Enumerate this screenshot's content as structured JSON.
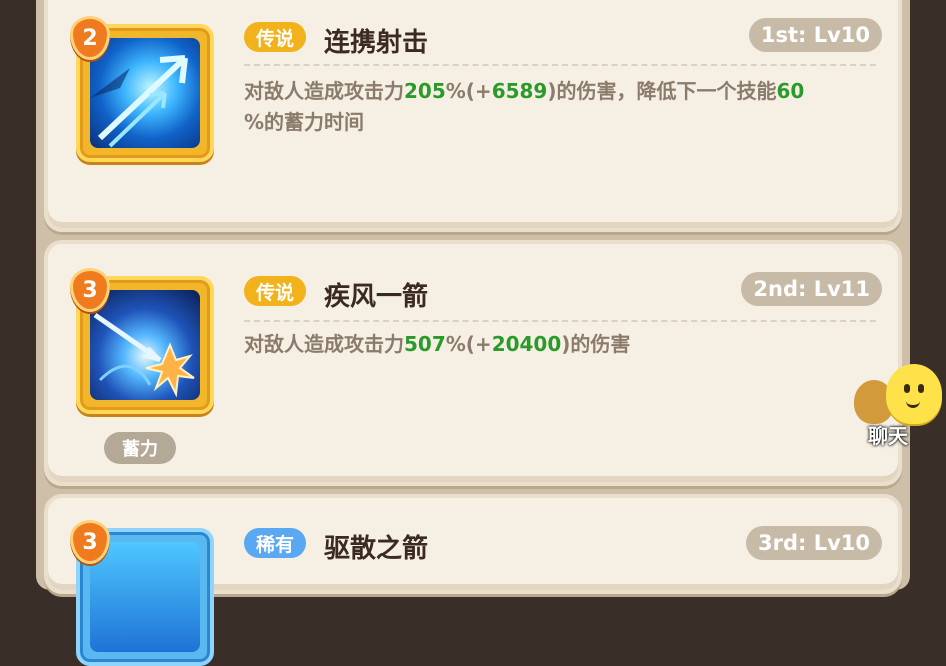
{
  "skills": [
    {
      "number": "2",
      "rarity": "传说",
      "name": "连携射击",
      "rank": "1st: Lv10",
      "desc_pre": "对敌人造成攻击力",
      "pct": "205",
      "mid1": "%(+",
      "bonus": "6589",
      "mid2": ")的伤害，降低下一个技能",
      "extra": "60",
      "post": "%的蓄力时间"
    },
    {
      "number": "3",
      "rarity": "传说",
      "name": "疾风一箭",
      "rank": "2nd: Lv11",
      "desc_pre": "对敌人造成攻击力",
      "pct": "507",
      "mid1": "%(+",
      "bonus": "20400",
      "post": ")的伤害",
      "tag": "蓄力"
    },
    {
      "number": "3",
      "rarity": "稀有",
      "name": "驱散之箭",
      "rank": "3rd: Lv10"
    }
  ],
  "chat": {
    "label": "聊天"
  },
  "colors": {
    "legend": "#f1b21b",
    "rare": "#5aa7f2",
    "highlight": "#2a9b2a"
  }
}
